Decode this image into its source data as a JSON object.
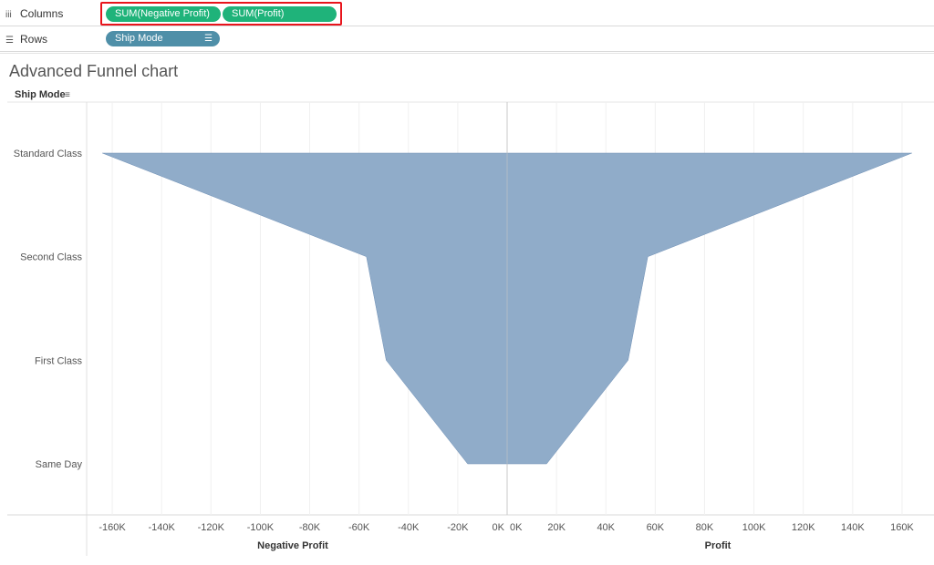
{
  "shelves": {
    "columns": {
      "label": "Columns",
      "pills": [
        "SUM(Negative Profit)",
        "SUM(Profit)"
      ]
    },
    "rows": {
      "label": "Rows",
      "pills": [
        "Ship Mode"
      ]
    }
  },
  "chart_title": "Advanced Funnel chart",
  "colors": {
    "area": "#8eaac8",
    "area_stroke": "#6e8fb5",
    "pill_green": "#1fb37a",
    "pill_blue": "#4f8fa8",
    "highlight": "#e8141c"
  },
  "chart_data": {
    "type": "area",
    "row_header": "Ship Mode",
    "categories": [
      "Standard Class",
      "Second Class",
      "First Class",
      "Same Day"
    ],
    "series": [
      {
        "name": "Negative Profit",
        "values": [
          -164000,
          -57000,
          -49000,
          -16000
        ]
      },
      {
        "name": "Profit",
        "values": [
          164000,
          57000,
          49000,
          16000
        ]
      }
    ],
    "xlabel_left": "Negative Profit",
    "xlabel_right": "Profit",
    "left_axis": {
      "range": [
        -170000,
        0
      ],
      "ticks": [
        -160000,
        -140000,
        -120000,
        -100000,
        -80000,
        -60000,
        -40000,
        -20000,
        0
      ],
      "tick_labels": [
        "-160K",
        "-140K",
        "-120K",
        "-100K",
        "-80K",
        "-60K",
        "-40K",
        "-20K",
        "0K"
      ]
    },
    "right_axis": {
      "range": [
        0,
        170000
      ],
      "ticks": [
        0,
        20000,
        40000,
        60000,
        80000,
        100000,
        120000,
        140000,
        160000
      ],
      "tick_labels": [
        "0K",
        "20K",
        "40K",
        "60K",
        "80K",
        "100K",
        "120K",
        "140K",
        "160K"
      ]
    },
    "grid": true
  }
}
